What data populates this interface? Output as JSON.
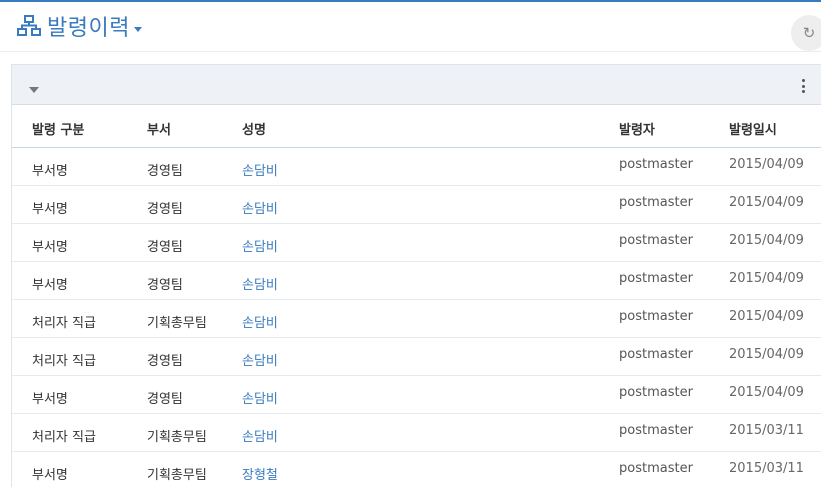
{
  "header": {
    "title": "발령이력"
  },
  "table": {
    "columns": {
      "type": "발령 구분",
      "dept": "부서",
      "name": "성명",
      "issuer": "발령자",
      "date": "발령일시"
    },
    "rows": [
      {
        "type": "부서명",
        "dept": "경영팀",
        "name": "손담비",
        "issuer": "postmaster",
        "date": "2015/04/09"
      },
      {
        "type": "부서명",
        "dept": "경영팀",
        "name": "손담비",
        "issuer": "postmaster",
        "date": "2015/04/09"
      },
      {
        "type": "부서명",
        "dept": "경영팀",
        "name": "손담비",
        "issuer": "postmaster",
        "date": "2015/04/09"
      },
      {
        "type": "부서명",
        "dept": "경영팀",
        "name": "손담비",
        "issuer": "postmaster",
        "date": "2015/04/09"
      },
      {
        "type": "처리자 직급",
        "dept": "기획총무팀",
        "name": "손담비",
        "issuer": "postmaster",
        "date": "2015/04/09"
      },
      {
        "type": "처리자 직급",
        "dept": "경영팀",
        "name": "손담비",
        "issuer": "postmaster",
        "date": "2015/04/09"
      },
      {
        "type": "부서명",
        "dept": "경영팀",
        "name": "손담비",
        "issuer": "postmaster",
        "date": "2015/04/09"
      },
      {
        "type": "처리자 직급",
        "dept": "기획총무팀",
        "name": "손담비",
        "issuer": "postmaster",
        "date": "2015/03/11"
      },
      {
        "type": "부서명",
        "dept": "기획총무팀",
        "name": "장형철",
        "issuer": "postmaster",
        "date": "2015/03/11"
      }
    ]
  },
  "icons": {
    "title": "org-chart-icon",
    "dropdown": "caret-down-icon",
    "refresh": "refresh-icon",
    "collapse": "caret-down-icon",
    "menu": "kebab-menu-icon"
  },
  "colors": {
    "accent": "#3a7bbf"
  }
}
